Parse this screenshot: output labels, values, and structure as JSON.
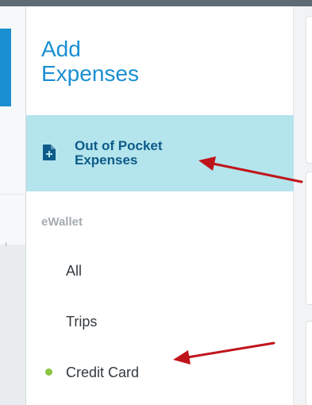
{
  "panel": {
    "title_line1": "Add",
    "title_line2": "Expenses"
  },
  "out_of_pocket": {
    "label_line1": "Out of Pocket",
    "label_line2": "Expenses",
    "icon": "document-plus-icon"
  },
  "ewallet": {
    "section_label": "eWallet",
    "items": [
      {
        "label": "All"
      },
      {
        "label": "Trips"
      },
      {
        "label": "Credit Card",
        "status_color": "#8cc43f"
      }
    ]
  },
  "annotations": {
    "arrow_color": "#c0141b"
  },
  "colors": {
    "accent": "#1a8fd1",
    "selected_bg": "#b4e4ec",
    "selected_text": "#0d5b8a"
  }
}
